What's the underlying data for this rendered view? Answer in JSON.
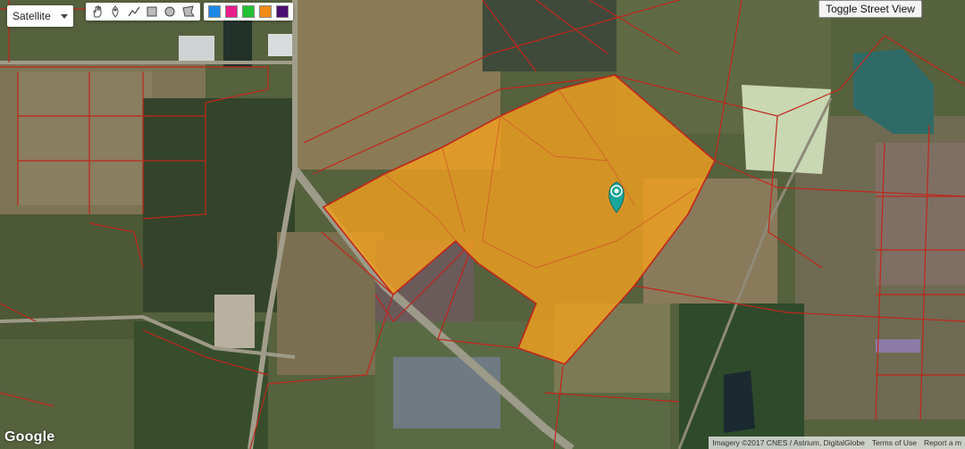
{
  "map": {
    "map_type_label": "Satellite",
    "street_view_label": "Toggle Street View",
    "brand": "Google",
    "attribution": {
      "imagery": "Imagery ©2017 CNES / Astrium, DigitalGlobe",
      "terms": "Terms of Use",
      "report": "Report a m"
    },
    "drawing_tools": [
      "hand-icon",
      "marker-icon",
      "polyline-icon",
      "rectangle-icon",
      "circle-icon",
      "polygon-icon"
    ],
    "color_swatches": [
      "#1e88e5",
      "#e91e8c",
      "#22c233",
      "#f28c17",
      "#4a0f6f"
    ],
    "accent": {
      "parcel_fill": "#f0a020",
      "parcel_border": "#c0261b",
      "marker": "#18a79a"
    }
  }
}
